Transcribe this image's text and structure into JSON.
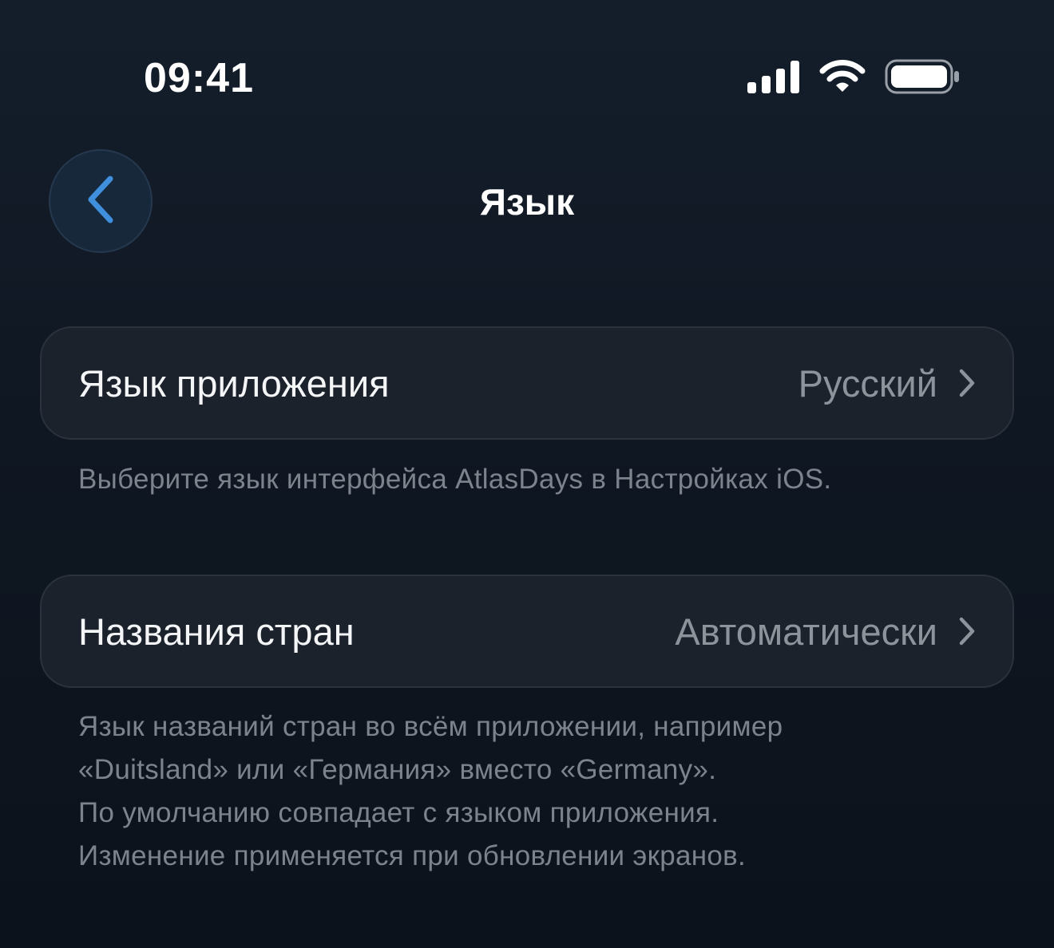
{
  "status_bar": {
    "time": "09:41"
  },
  "nav": {
    "title": "Язык",
    "back_icon": "chevron-left-icon"
  },
  "settings": {
    "app_language": {
      "label": "Язык приложения",
      "value": "Русский",
      "footnote": "Выберите язык интерфейса AtlasDays в Настройках iOS."
    },
    "country_names": {
      "label": "Названия стран",
      "value": "Автоматически",
      "footnote_lines": [
        "Язык названий стран во всём приложении, например",
        "«Duitsland» или «Германия» вместо «Germany».",
        "По умолчанию совпадает с языком приложения.",
        "Изменение применяется при обновлении экранов."
      ]
    }
  },
  "colors": {
    "accent": "#3f8fdd",
    "background": "#0f1722",
    "card": "#1c222c",
    "secondary_text": "#8d939b"
  }
}
